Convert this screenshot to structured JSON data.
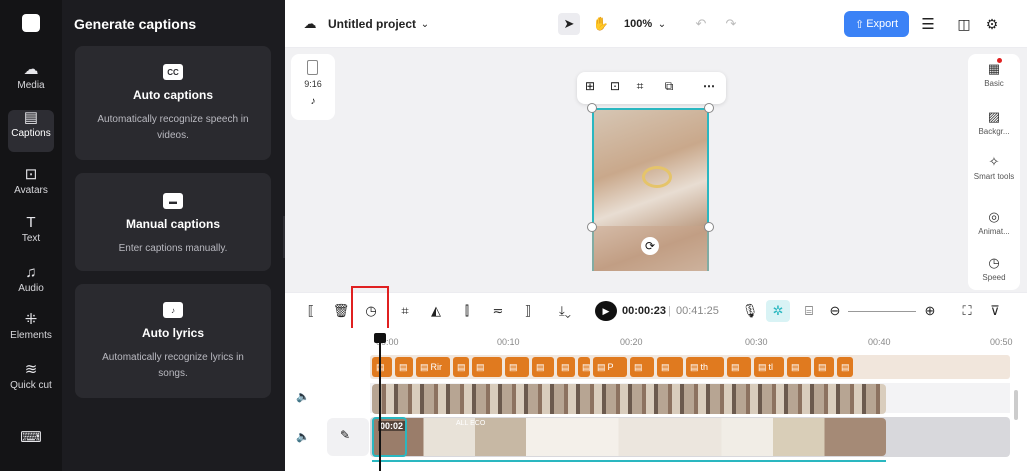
{
  "rail": {
    "items": [
      {
        "icon": "media-icon",
        "label": "Media",
        "glyph": "☁"
      },
      {
        "icon": "captions-icon",
        "label": "Captions",
        "glyph": "▤"
      },
      {
        "icon": "avatars-icon",
        "label": "Avatars",
        "glyph": "⊡"
      },
      {
        "icon": "text-icon",
        "label": "Text",
        "glyph": "T"
      },
      {
        "icon": "audio-icon",
        "label": "Audio",
        "glyph": "♫"
      },
      {
        "icon": "elements-icon",
        "label": "Elements",
        "glyph": "⁜"
      },
      {
        "icon": "quick-cut-icon",
        "label": "Quick cut",
        "glyph": "≋"
      },
      {
        "icon": "keyboard-icon",
        "label": "",
        "glyph": "⌨"
      }
    ]
  },
  "panel": {
    "title": "Generate captions",
    "cards": [
      {
        "icon": "cc-icon",
        "icon_text": "CC",
        "title": "Auto captions",
        "desc": "Automatically recognize speech in videos."
      },
      {
        "icon": "manual-captions-icon",
        "icon_text": "▬",
        "title": "Manual captions",
        "desc": "Enter captions manually."
      },
      {
        "icon": "auto-lyrics-icon",
        "icon_text": "♪",
        "title": "Auto lyrics",
        "desc": "Automatically recognize lyrics in songs."
      }
    ]
  },
  "topbar": {
    "project_name": "Untitled project",
    "zoom": "100%",
    "export_label": "Export"
  },
  "canvas": {
    "aspect_ratio": "9:16",
    "float_tools": [
      "⊞",
      "⊡",
      "⌗",
      "⧉",
      "⋯"
    ]
  },
  "right_panel": {
    "items": [
      {
        "icon": "basic-icon",
        "label": "Basic",
        "glyph": "▦"
      },
      {
        "icon": "background-icon",
        "label": "Backgr...",
        "glyph": "▨"
      },
      {
        "icon": "smart-tools-icon",
        "label": "Smart tools",
        "glyph": "✧"
      },
      {
        "icon": "animation-icon",
        "label": "Animat...",
        "glyph": "◎"
      },
      {
        "icon": "speed-icon",
        "label": "Speed",
        "glyph": "◷"
      }
    ]
  },
  "timeline": {
    "current_time": "00:00:23",
    "total_time": "00:41:25",
    "ruler": [
      "00:00",
      "00:10",
      "00:20",
      "00:30",
      "00:40",
      "00:50"
    ],
    "caption_texts": [
      "",
      "",
      "Rir",
      "",
      "",
      "",
      "",
      "",
      "",
      "P",
      "",
      "",
      "th",
      "",
      "tl",
      "",
      "",
      ""
    ],
    "main_clip_time": "00:02",
    "main_clip_caption": "ALL ECO"
  },
  "colors": {
    "accent": "#3b82f6",
    "caption": "#e07a1f",
    "selection": "#2ab7c0",
    "highlight": "#e02020"
  }
}
